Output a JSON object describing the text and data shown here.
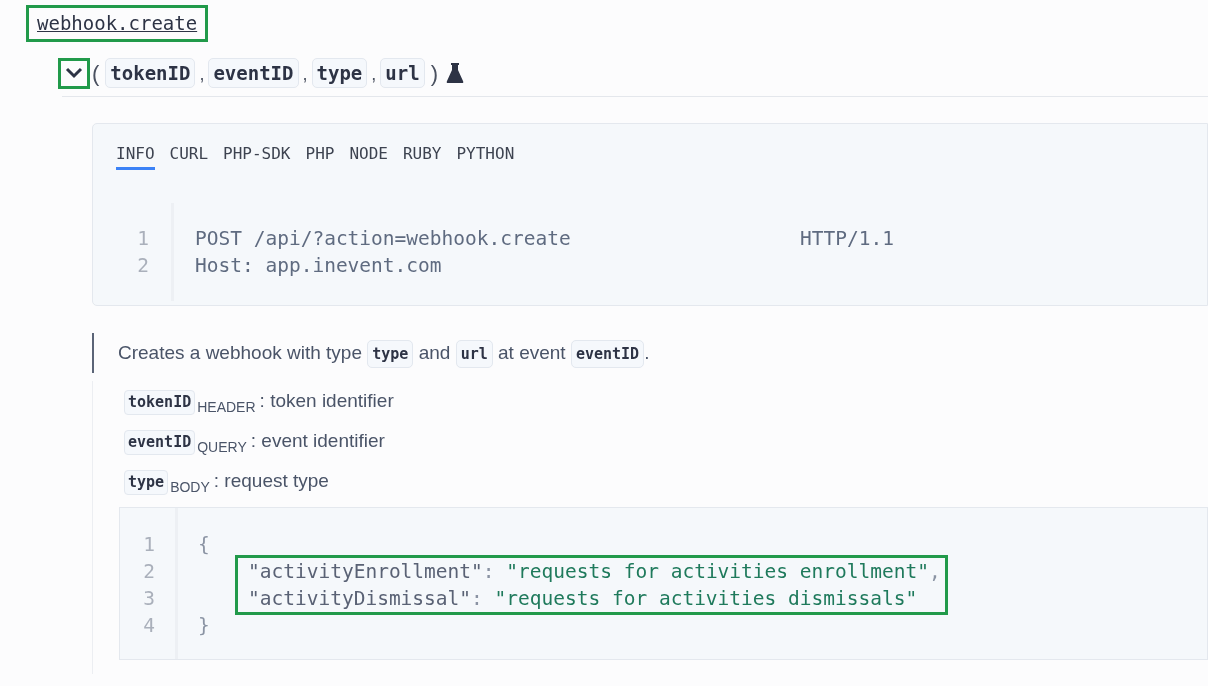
{
  "method": {
    "name": "webhook.create",
    "highlighted": true
  },
  "signature": {
    "expanded": true,
    "open": "(",
    "separator": ",",
    "close": ")",
    "params": [
      "tokenID",
      "eventID",
      "type",
      "url"
    ]
  },
  "tabs": [
    {
      "label": "INFO",
      "selected": true
    },
    {
      "label": "CURL",
      "selected": false
    },
    {
      "label": "PHP-SDK",
      "selected": false
    },
    {
      "label": "PHP",
      "selected": false
    },
    {
      "label": "NODE",
      "selected": false
    },
    {
      "label": "RUBY",
      "selected": false
    },
    {
      "label": "PYTHON",
      "selected": false
    }
  ],
  "request": [
    {
      "number": "1",
      "text": "POST /api/?action=webhook.create",
      "version": "HTTP/1.1"
    },
    {
      "number": "2",
      "text": "Host: app.inevent.com"
    }
  ],
  "description": [
    {
      "kind": "text",
      "text": "Creates a webhook with type "
    },
    {
      "kind": "code",
      "text": "type"
    },
    {
      "kind": "text",
      "text": " and "
    },
    {
      "kind": "code",
      "text": "url"
    },
    {
      "kind": "text",
      "text": " at event "
    },
    {
      "kind": "code",
      "text": "eventID"
    },
    {
      "kind": "text",
      "text": "."
    }
  ],
  "parameters": [
    {
      "name": "tokenID",
      "location": "HEADER",
      "text": ": token identifier"
    },
    {
      "name": "eventID",
      "location": "QUERY",
      "text": ": event identifier"
    },
    {
      "name": "type",
      "location": "BODY",
      "text": ": request type"
    }
  ],
  "example": {
    "lines": [
      {
        "number": "1",
        "highlighted": false,
        "tokens": [
          {
            "kind": "punct",
            "text": "{"
          }
        ]
      },
      {
        "number": "2",
        "highlighted": true,
        "tokens": [
          {
            "kind": "key",
            "text": "\"activityEnrollment\""
          },
          {
            "kind": "punct",
            "text": ": "
          },
          {
            "kind": "string",
            "text": "\"requests for activities enrollment\""
          },
          {
            "kind": "punct",
            "text": ","
          }
        ]
      },
      {
        "number": "3",
        "highlighted": true,
        "tokens": [
          {
            "kind": "key",
            "text": "\"activityDismissal\""
          },
          {
            "kind": "punct",
            "text": ": "
          },
          {
            "kind": "string",
            "text": "\"requests for activities dismissals\""
          }
        ]
      },
      {
        "number": "4",
        "highlighted": false,
        "tokens": [
          {
            "kind": "punct",
            "text": "}"
          }
        ]
      }
    ]
  }
}
